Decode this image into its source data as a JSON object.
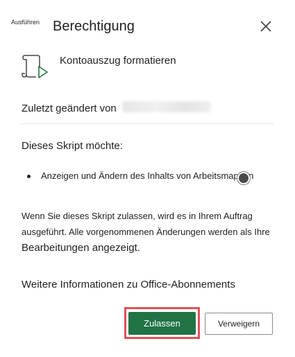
{
  "header": {
    "label": "Ausführen",
    "title": "Berechtigung",
    "close_icon": "close-icon"
  },
  "script": {
    "icon": "script-run-icon",
    "name": "Kontoauszug formatieren"
  },
  "author": {
    "label": "Zuletzt geändert von"
  },
  "permissions": {
    "heading": "Dieses Skript möchte:",
    "items": [
      "Anzeigen und Ändern des Inhalts von Arbeitsmappen"
    ]
  },
  "info": {
    "line1": "Wenn Sie dieses Skript zulassen, wird es in Ihrem Auftrag",
    "line2": "ausgeführt. Alle vorgenommenen Änderungen werden als Ihre",
    "line3": "Bearbeitungen angezeigt."
  },
  "more_info": "Weitere Informationen zu Office-Abonnements",
  "buttons": {
    "allow": "Zulassen",
    "deny": "Verweigern"
  },
  "colors": {
    "accent": "#217346",
    "highlight": "#e0505b"
  }
}
